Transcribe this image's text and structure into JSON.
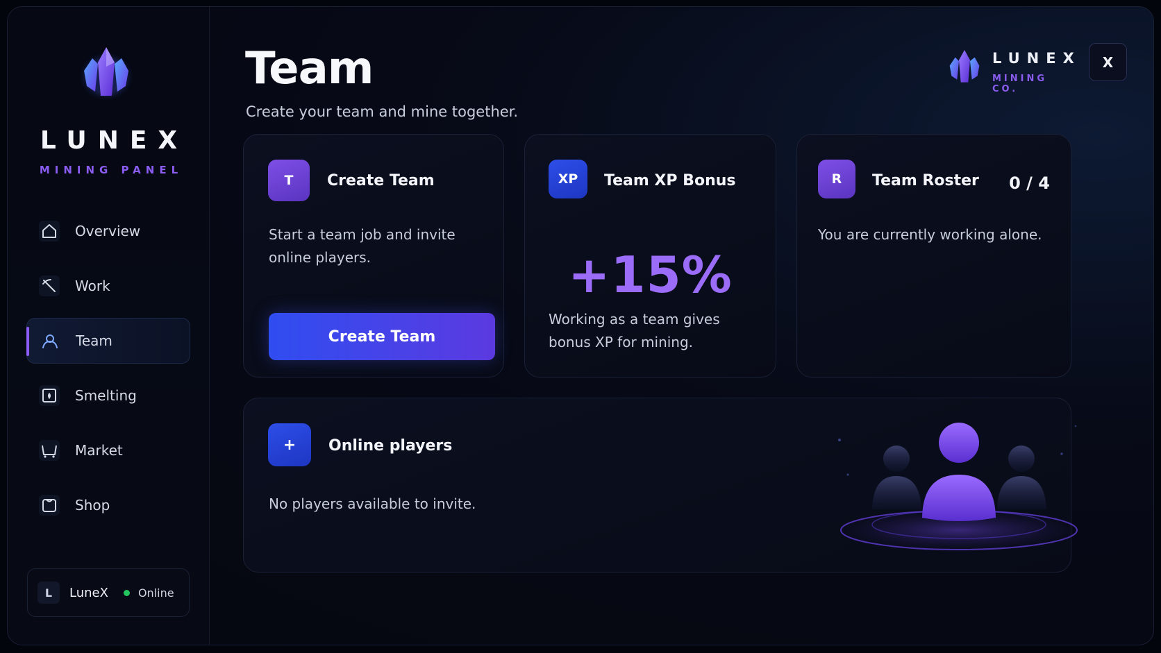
{
  "sidebar": {
    "brand_title": "LUNEX",
    "brand_subtitle": "MINING PANEL",
    "items": [
      {
        "label": "Overview",
        "icon": "home-icon",
        "active": false
      },
      {
        "label": "Work",
        "icon": "pickaxe-icon",
        "active": false
      },
      {
        "label": "Team",
        "icon": "user-icon",
        "active": true
      },
      {
        "label": "Smelting",
        "icon": "furnace-icon",
        "active": false
      },
      {
        "label": "Market",
        "icon": "cart-icon",
        "active": false
      },
      {
        "label": "Shop",
        "icon": "shop-icon",
        "active": false
      }
    ],
    "user": {
      "initial": "L",
      "name": "LuneX",
      "status": "Online"
    }
  },
  "header": {
    "title": "Team",
    "subtitle": "Create your team and mine together.",
    "brand_title": "LUNEX",
    "brand_subtitle": "MINING CO.",
    "close_label": "X"
  },
  "cards": {
    "create_team": {
      "badge": "T",
      "title": "Create Team",
      "text": "Start a team job and invite online players.",
      "button": "Create Team"
    },
    "xp_bonus": {
      "badge": "XP",
      "title": "Team XP Bonus",
      "value": "+15%",
      "text": "Working as a team gives bonus XP for mining."
    },
    "roster": {
      "badge": "R",
      "title": "Team Roster",
      "count": "0 / 4",
      "text": "You are currently working alone."
    },
    "online_players": {
      "badge": "+",
      "title": "Online players",
      "text": "No players available to invite."
    }
  },
  "colors": {
    "accent_purple": "#8b5cf6",
    "accent_blue": "#2f4df0",
    "online_green": "#22c55e"
  }
}
